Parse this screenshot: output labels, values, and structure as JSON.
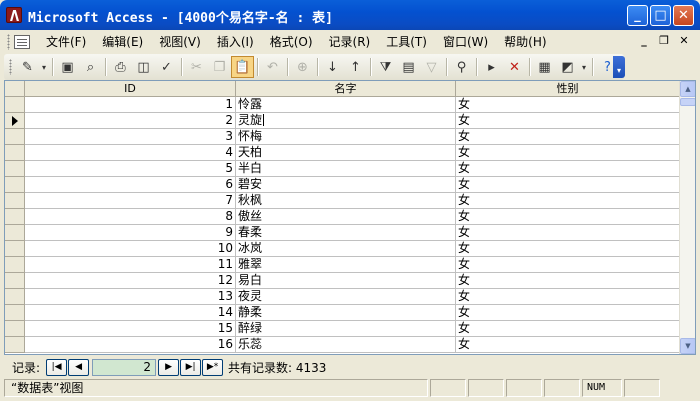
{
  "window": {
    "title": "Microsoft Access - [4000个易名字-名 : 表]",
    "min_glyph": "_",
    "max_glyph": "□",
    "close_glyph": "✕"
  },
  "menu": {
    "items": [
      "文件(F)",
      "编辑(E)",
      "视图(V)",
      "插入(I)",
      "格式(O)",
      "记录(R)",
      "工具(T)",
      "窗口(W)",
      "帮助(H)"
    ],
    "doc_min": "_",
    "doc_restore": "❐",
    "doc_close": "✕"
  },
  "toolbar": {
    "icons": [
      "design-view-icon",
      "dropdown-icon",
      "save-icon",
      "search-icon",
      "print-icon",
      "print-preview-icon",
      "spelling-icon",
      "cut-icon",
      "copy-icon",
      "paste-icon",
      "undo-icon",
      "hyperlink-icon",
      "sort-asc-icon",
      "sort-desc-icon",
      "filter-selection-icon",
      "filter-form-icon",
      "apply-filter-icon",
      "find-icon",
      "new-record-icon",
      "delete-record-icon",
      "database-window-icon",
      "new-object-icon",
      "help-icon"
    ]
  },
  "table": {
    "columns": [
      "ID",
      "名字",
      "性别"
    ],
    "rows": [
      {
        "id": "1",
        "name": "怜露",
        "gender": "女"
      },
      {
        "id": "2",
        "name": "灵旋",
        "gender": "女"
      },
      {
        "id": "3",
        "name": "怀梅",
        "gender": "女"
      },
      {
        "id": "4",
        "name": "天柏",
        "gender": "女"
      },
      {
        "id": "5",
        "name": "半白",
        "gender": "女"
      },
      {
        "id": "6",
        "name": "碧安",
        "gender": "女"
      },
      {
        "id": "7",
        "name": "秋枫",
        "gender": "女"
      },
      {
        "id": "8",
        "name": "傲丝",
        "gender": "女"
      },
      {
        "id": "9",
        "name": "春柔",
        "gender": "女"
      },
      {
        "id": "10",
        "name": "冰岚",
        "gender": "女"
      },
      {
        "id": "11",
        "name": "雅翠",
        "gender": "女"
      },
      {
        "id": "12",
        "name": "易白",
        "gender": "女"
      },
      {
        "id": "13",
        "name": "夜灵",
        "gender": "女"
      },
      {
        "id": "14",
        "name": "静柔",
        "gender": "女"
      },
      {
        "id": "15",
        "name": "醉绿",
        "gender": "女"
      },
      {
        "id": "16",
        "name": "乐蕊",
        "gender": "女"
      }
    ]
  },
  "navigation": {
    "label": "记录:",
    "current": "2",
    "total_label": "共有记录数: 4133"
  },
  "status": {
    "view": "“数据表”视图",
    "num": "NUM"
  }
}
